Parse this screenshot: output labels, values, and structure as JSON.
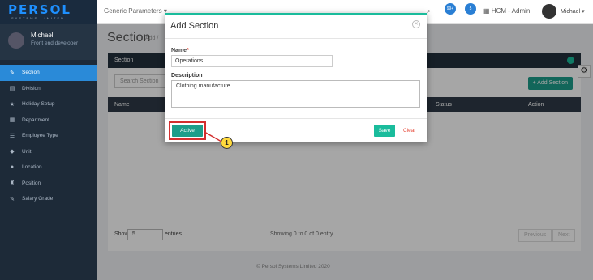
{
  "header": {
    "logo": "PERSOL",
    "logo_sub": "SYSTEMS LIMITED",
    "module_dropdown": "Generic Parameters",
    "notif_badge_1": "99+",
    "notif_badge_2": "5",
    "app_name": "HCM - Admin",
    "user_name": "Michael"
  },
  "sidebar": {
    "user_name": "Michael",
    "user_role": "Front end developer",
    "items": [
      {
        "label": "Section",
        "icon": "pin-icon",
        "glyph": "✎"
      },
      {
        "label": "Division",
        "icon": "grid-icon",
        "glyph": "▤"
      },
      {
        "label": "Holiday Setup",
        "icon": "star-icon",
        "glyph": "★"
      },
      {
        "label": "Department",
        "icon": "building-icon",
        "glyph": "▦"
      },
      {
        "label": "Employee Type",
        "icon": "people-icon",
        "glyph": "☰"
      },
      {
        "label": "Unit",
        "icon": "diamond-icon",
        "glyph": "◆"
      },
      {
        "label": "Location",
        "icon": "marker-icon",
        "glyph": "●"
      },
      {
        "label": "Position",
        "icon": "graduation-icon",
        "glyph": "♜"
      },
      {
        "label": "Salary Grade",
        "icon": "pin2-icon",
        "glyph": "✎"
      }
    ]
  },
  "main": {
    "page_title": "Section",
    "page_sub": "Add /",
    "panel_title": "Section",
    "search_placeholder": "Search Section",
    "add_button": "+ Add Section",
    "columns": [
      "Name",
      "Status",
      "Action"
    ],
    "show_label": "Show",
    "show_value": "5",
    "entries_label": "entries",
    "showing_text": "Showing 0 to 0 of 0 entry",
    "prev_label": "Previous",
    "next_label": "Next",
    "footer": "© Persol Systems Limited 2020"
  },
  "modal": {
    "title": "Add Section",
    "name_label": "Name",
    "name_required": "*",
    "name_value": "Operations",
    "desc_label": "Description",
    "desc_value": "Clothing manufacture",
    "active_button": "Active",
    "save_button": "Save",
    "clear_button": "Clear"
  },
  "callout": {
    "number": "1",
    "color": "#ffd93d",
    "highlight_color": "#d32f2f"
  },
  "colors": {
    "accent": "#1abc9c",
    "sidebar_bg": "#1d2a38",
    "active_nav": "#2a8ad8",
    "primary_btn": "#1c9d8a"
  }
}
